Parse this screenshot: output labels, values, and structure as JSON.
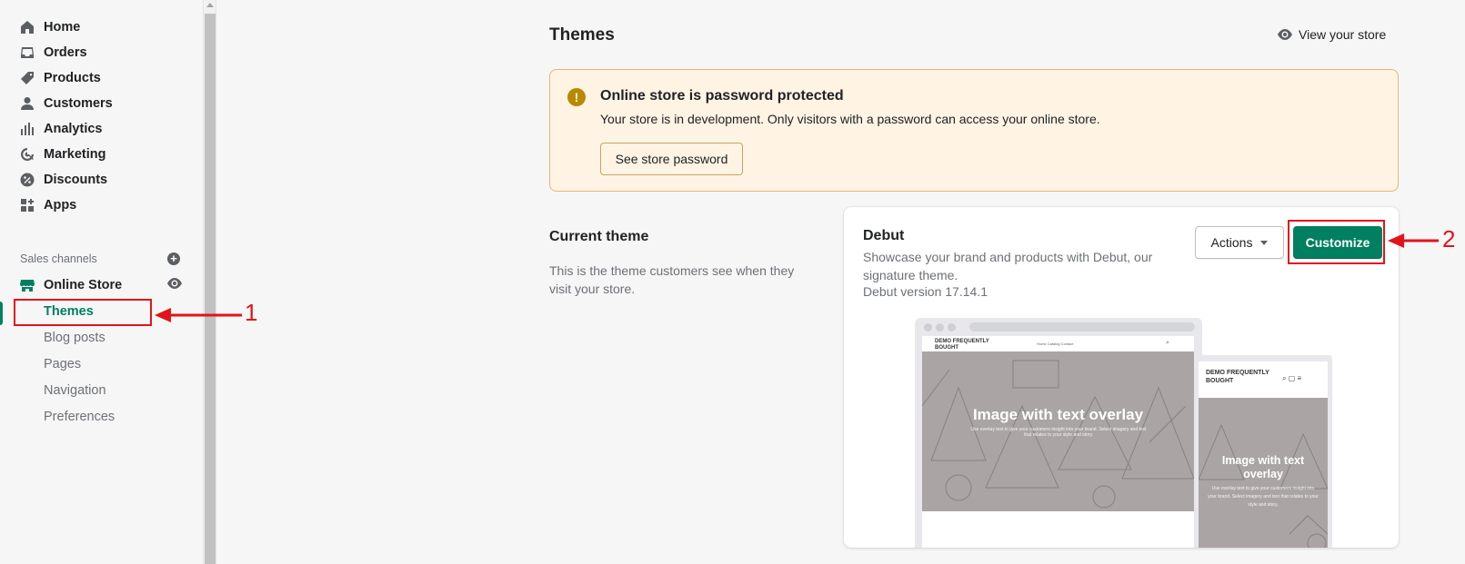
{
  "sidebar": {
    "items": [
      {
        "label": "Home",
        "icon": "home-icon"
      },
      {
        "label": "Orders",
        "icon": "inbox-icon"
      },
      {
        "label": "Products",
        "icon": "tag-icon"
      },
      {
        "label": "Customers",
        "icon": "person-icon"
      },
      {
        "label": "Analytics",
        "icon": "bar-chart-icon"
      },
      {
        "label": "Marketing",
        "icon": "target-icon"
      },
      {
        "label": "Discounts",
        "icon": "discount-icon"
      },
      {
        "label": "Apps",
        "icon": "apps-icon"
      }
    ],
    "sales_channels_label": "Sales channels",
    "online_store_label": "Online Store",
    "sub_items": [
      {
        "label": "Themes",
        "active": true
      },
      {
        "label": "Blog posts"
      },
      {
        "label": "Pages"
      },
      {
        "label": "Navigation"
      },
      {
        "label": "Preferences"
      }
    ]
  },
  "header": {
    "title": "Themes",
    "view_store_label": "View your store"
  },
  "banner": {
    "title": "Online store is password protected",
    "description": "Your store is in development. Only visitors with a password can access your online store.",
    "button_label": "See store password",
    "icon": "alert-icon",
    "accent": "#b98900"
  },
  "current_theme": {
    "heading": "Current theme",
    "description": "This is the theme customers see when they visit your store.",
    "theme_name": "Debut",
    "theme_description": "Showcase your brand and products with Debut, our signature theme.",
    "version": "Debut version 17.14.1",
    "actions_label": "Actions",
    "customize_label": "Customize",
    "primary_color": "#008060"
  },
  "preview": {
    "store_name": "DEMO FREQUENTLY BOUGHT",
    "nav_links": "Home   Catalog   Contact",
    "hero_title": "Image with text overlay",
    "hero_subtitle": "Use overlay text to give your customers insight into your brand. Select imagery and text that relates to your style and story.",
    "mobile_store_name": "DEMO FREQUENTLY BOUGHT",
    "mobile_hero_title": "Image with text overlay",
    "mobile_hero_subtitle": "Use overlay text to give your customers insight into your brand. Select imagery and text that relates to your style and story."
  },
  "annotations": {
    "step1": "1",
    "step2": "2",
    "color": "#e2141a"
  }
}
